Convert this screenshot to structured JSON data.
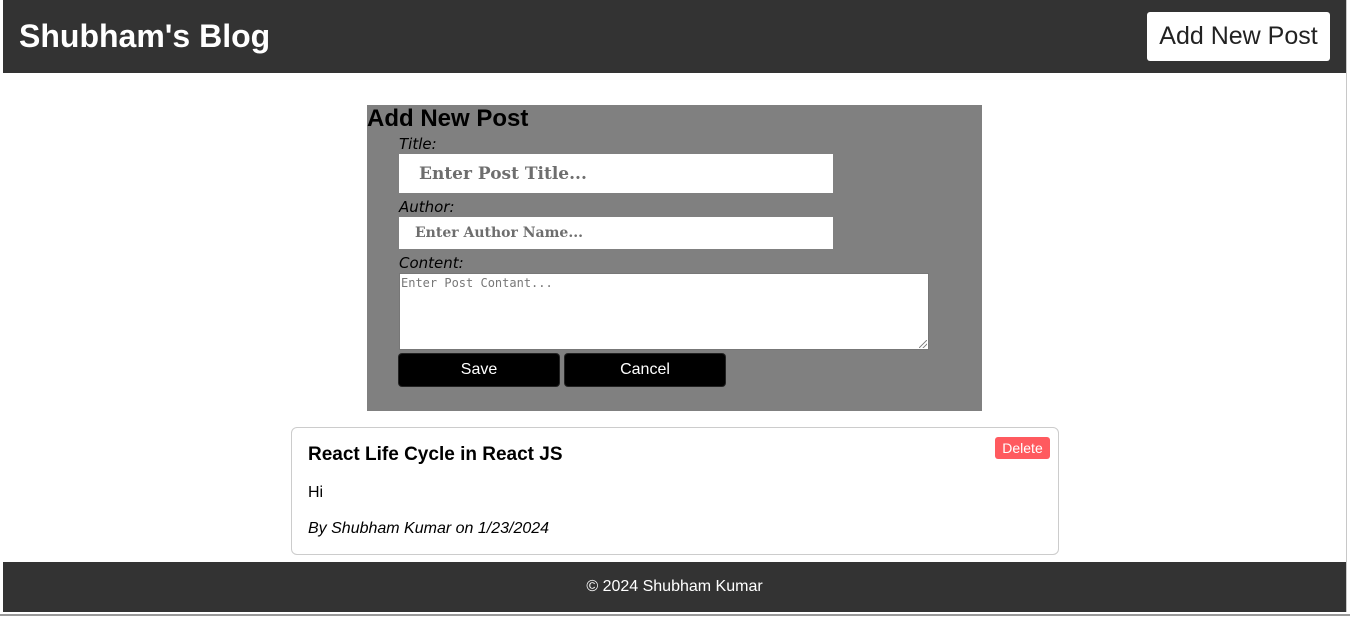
{
  "header": {
    "site_title": "Shubham's Blog",
    "add_post_label": "Add New Post"
  },
  "form": {
    "heading": "Add New Post",
    "title_label": "Title:",
    "title_placeholder": "Enter Post Title...",
    "author_label": "Author:",
    "author_placeholder": "Enter Author Name...",
    "content_label": "Content:",
    "content_placeholder": "Enter Post Contant...",
    "save_label": "Save",
    "cancel_label": "Cancel"
  },
  "posts": [
    {
      "title": "React Life Cycle in React JS",
      "content": "Hi",
      "meta": "By Shubham Kumar on 1/23/2024",
      "delete_label": "Delete"
    }
  ],
  "footer": {
    "text": "© 2024 Shubham Kumar"
  },
  "colors": {
    "header_bg": "#333333",
    "form_bg": "#808080",
    "delete_bg": "#ff5a5f",
    "button_bg": "#000000"
  }
}
